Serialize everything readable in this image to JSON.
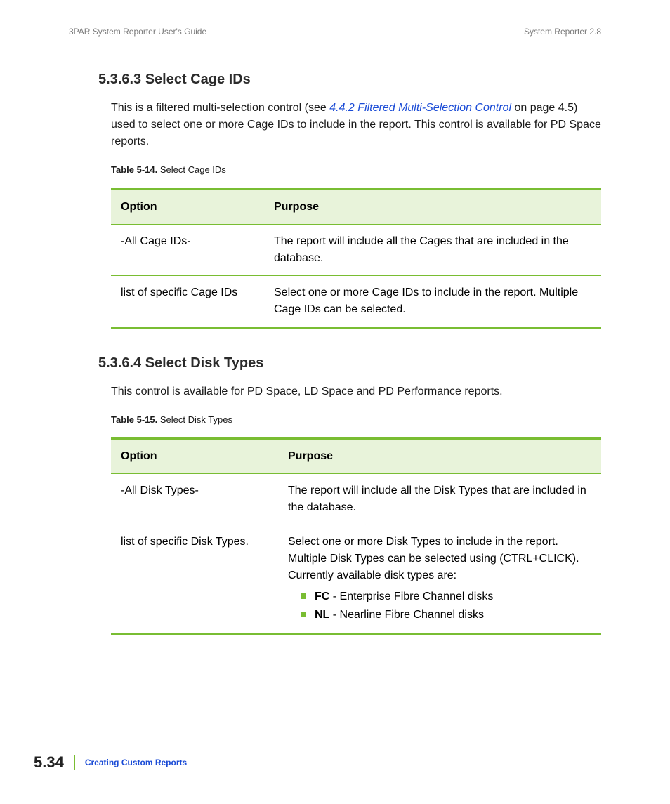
{
  "header": {
    "left": "3PAR System Reporter User's Guide",
    "right": "System Reporter 2.8"
  },
  "section_a": {
    "heading": "5.3.6.3 Select Cage IDs",
    "para_pre": "This is a filtered multi-selection control (see ",
    "link": "4.4.2 Filtered Multi-Selection Control",
    "para_mid": " on page 4.5) used to select one or more Cage IDs to include in the report. This control is available for PD Space reports.",
    "caption_label": "Table 5-14.",
    "caption_text": "Select Cage IDs",
    "thead_option": "Option",
    "thead_purpose": "Purpose",
    "rows": [
      {
        "option": "-All Cage IDs-",
        "purpose": "The report will include all the Cages that are included in the database."
      },
      {
        "option": "list of specific Cage IDs",
        "purpose": "Select one or more Cage IDs to include in the report. Multiple Cage IDs can be selected."
      }
    ]
  },
  "section_b": {
    "heading": "5.3.6.4 Select Disk Types",
    "para": "This control is available for PD Space, LD Space and PD Performance reports.",
    "caption_label": "Table 5-15.",
    "caption_text": "Select Disk Types",
    "thead_option": "Option",
    "thead_purpose": "Purpose",
    "rows": [
      {
        "option": "-All Disk Types-",
        "purpose": "The report will include all the Disk Types that are included in the database."
      },
      {
        "option": "list of specific Disk Types.",
        "purpose_intro": "Select one or more Disk Types to include in the report. Multiple Disk Types can be selected using (CTRL+CLICK). Currently available disk types are:",
        "items": [
          {
            "bold": "FC",
            "rest": " - Enterprise Fibre Channel disks"
          },
          {
            "bold": "NL",
            "rest": " - Nearline Fibre Channel disks"
          }
        ]
      }
    ]
  },
  "footer": {
    "page": "5.34",
    "chapter": "Creating Custom Reports"
  }
}
